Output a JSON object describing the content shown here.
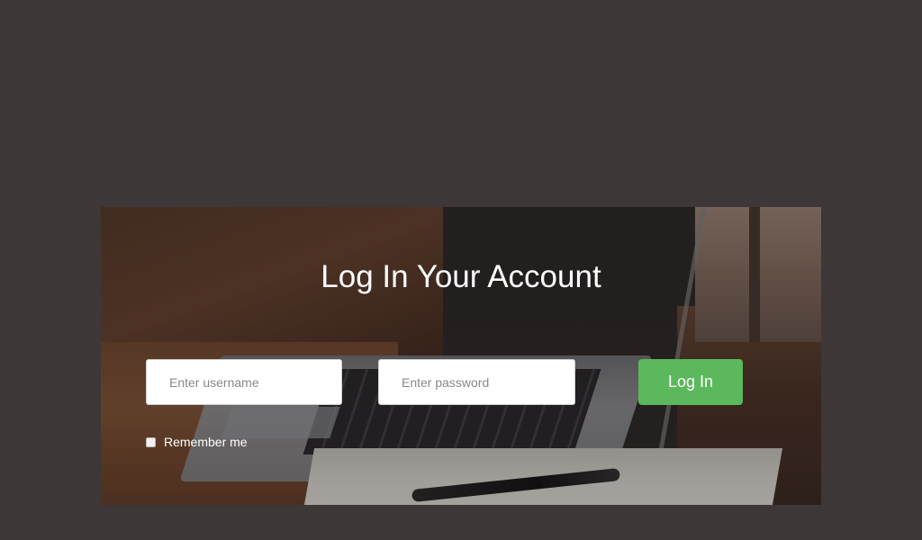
{
  "login": {
    "title": "Log In Your Account",
    "username_placeholder": "Enter username",
    "password_placeholder": "Enter password",
    "submit_label": "Log In",
    "remember_label": "Remember me",
    "remember_checked": false
  },
  "colors": {
    "page_background": "#3d3738",
    "button": "#5cb85c",
    "title_text": "#ffffff"
  }
}
